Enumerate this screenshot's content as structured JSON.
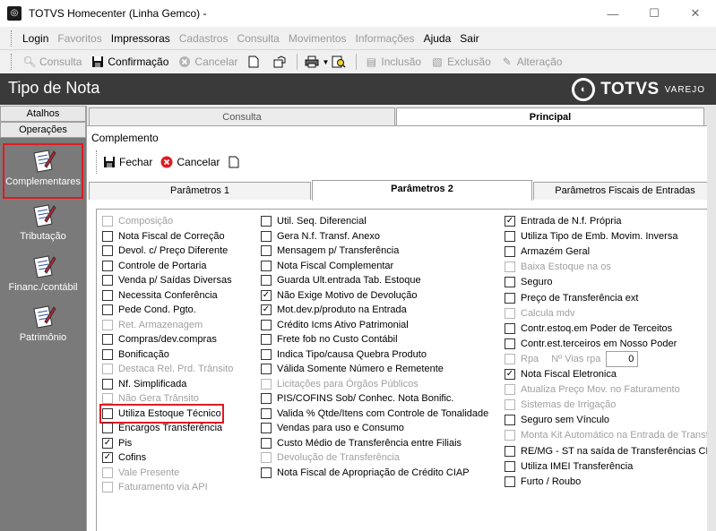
{
  "window": {
    "title": "TOTVS Homecenter (Linha Gemco) -",
    "minimize": "—",
    "maximize": "☐",
    "close": "✕"
  },
  "menu": [
    {
      "label": "Login",
      "enabled": true
    },
    {
      "label": "Favoritos",
      "enabled": false
    },
    {
      "label": "Impressoras",
      "enabled": true
    },
    {
      "label": "Cadastros",
      "enabled": false
    },
    {
      "label": "Consulta",
      "enabled": false
    },
    {
      "label": "Movimentos",
      "enabled": false
    },
    {
      "label": "Informações",
      "enabled": false
    },
    {
      "label": "Ajuda",
      "enabled": true
    },
    {
      "label": "Sair",
      "enabled": true
    }
  ],
  "toolbar": {
    "consulta": "Consulta",
    "confirmacao": "Confirmação",
    "cancelar": "Cancelar",
    "inclusao": "Inclusão",
    "exclusao": "Exclusão",
    "alteracao": "Alteração"
  },
  "header": {
    "title": "Tipo de Nota",
    "brand": "TOTVS",
    "brand_sub": "VAREJO"
  },
  "nav": {
    "atalhos": "Atalhos",
    "operacoes": "Operações",
    "items": [
      {
        "label": "Complementares",
        "selected": true
      },
      {
        "label": "Tributação",
        "selected": false
      },
      {
        "label": "Financ./contábil",
        "selected": false
      },
      {
        "label": "Patrimônio",
        "selected": false
      }
    ]
  },
  "top_tabs": {
    "consulta": "Consulta",
    "principal": "Principal"
  },
  "dialog": {
    "title": "Complemento",
    "fechar": "Fechar",
    "cancelar": "Cancelar",
    "tabs": {
      "p1": "Parâmetros 1",
      "p2": "Parâmetros 2",
      "p3": "Parâmetros Fiscais de Entradas"
    }
  },
  "params": {
    "col1": [
      {
        "label": "Composição",
        "checked": false,
        "disabled": true
      },
      {
        "label": "Nota Fiscal de Correção",
        "checked": false,
        "disabled": false
      },
      {
        "label": "Devol. c/ Preço Diferente",
        "checked": false,
        "disabled": false
      },
      {
        "label": "Controle de Portaria",
        "checked": false,
        "disabled": false
      },
      {
        "label": "Venda p/ Saídas Diversas",
        "checked": false,
        "disabled": false
      },
      {
        "label": "Necessita Conferência",
        "checked": false,
        "disabled": false
      },
      {
        "label": "Pede Cond. Pgto.",
        "checked": false,
        "disabled": false
      },
      {
        "label": "Ret. Armazenagem",
        "checked": false,
        "disabled": true
      },
      {
        "label": "Compras/dev.compras",
        "checked": false,
        "disabled": false
      },
      {
        "label": "Bonificação",
        "checked": false,
        "disabled": false
      },
      {
        "label": "Destaca Rel. Prd. Trânsito",
        "checked": false,
        "disabled": true
      },
      {
        "label": "Nf. Simplificada",
        "checked": false,
        "disabled": false
      },
      {
        "label": "Não Gera Trânsito",
        "checked": false,
        "disabled": true
      },
      {
        "label": "Utiliza Estoque Técnico",
        "checked": false,
        "disabled": false,
        "highlight": true
      },
      {
        "label": "Encargos Transferência",
        "checked": false,
        "disabled": false
      },
      {
        "label": "Pis",
        "checked": true,
        "disabled": false
      },
      {
        "label": "Cofins",
        "checked": true,
        "disabled": false
      },
      {
        "label": "Vale Presente",
        "checked": false,
        "disabled": true
      },
      {
        "label": "Faturamento via API",
        "checked": false,
        "disabled": true
      }
    ],
    "col2": [
      {
        "label": "Util. Seq. Diferencial",
        "checked": false,
        "disabled": false
      },
      {
        "label": "Gera N.f. Transf. Anexo",
        "checked": false,
        "disabled": false
      },
      {
        "label": "Mensagem p/ Transferência",
        "checked": false,
        "disabled": false
      },
      {
        "label": "Nota Fiscal Complementar",
        "checked": false,
        "disabled": false
      },
      {
        "label": "Guarda Ult.entrada Tab. Estoque",
        "checked": false,
        "disabled": false
      },
      {
        "label": "Não Exige Motivo de Devolução",
        "checked": true,
        "disabled": false
      },
      {
        "label": "Mot.dev.p/produto na Entrada",
        "checked": true,
        "disabled": false
      },
      {
        "label": "Crédito Icms Ativo Patrimonial",
        "checked": false,
        "disabled": false
      },
      {
        "label": "Frete fob no Custo Contábil",
        "checked": false,
        "disabled": false
      },
      {
        "label": "Indica Tipo/causa Quebra Produto",
        "checked": false,
        "disabled": false
      },
      {
        "label": "Válida Somente Número e Remetente",
        "checked": false,
        "disabled": false
      },
      {
        "label": "Licitações para Órgãos Públicos",
        "checked": false,
        "disabled": true
      },
      {
        "label": "PIS/COFINS Sob/ Conhec. Nota Bonific.",
        "checked": false,
        "disabled": false
      },
      {
        "label": "Valida % Qtde/Itens com Controle de Tonalidade",
        "checked": false,
        "disabled": false
      },
      {
        "label": "Vendas para uso e Consumo",
        "checked": false,
        "disabled": false
      },
      {
        "label": "Custo Médio de Transferência entre Filiais",
        "checked": false,
        "disabled": false
      },
      {
        "label": "Devolução de Transferência",
        "checked": false,
        "disabled": true
      },
      {
        "label": "Nota Fiscal de Apropriação de Crédito CIAP",
        "checked": false,
        "disabled": false
      }
    ],
    "col3": [
      {
        "label": "Entrada de N.f. Própria",
        "checked": true,
        "disabled": false
      },
      {
        "label": "Utiliza Tipo de Emb. Movim. Inversa",
        "checked": false,
        "disabled": false
      },
      {
        "label": "Armazém Geral",
        "checked": false,
        "disabled": false
      },
      {
        "label": "Baixa Estoque na os",
        "checked": false,
        "disabled": true
      },
      {
        "label": "Seguro",
        "checked": false,
        "disabled": false
      },
      {
        "label": "Preço de Transferência ext",
        "checked": false,
        "disabled": false
      },
      {
        "label": "Calcula mdv",
        "checked": false,
        "disabled": true
      },
      {
        "label": "Contr.estoq.em Poder de Terceitos",
        "checked": false,
        "disabled": false
      },
      {
        "label": "Contr.est.terceiros em Nosso Poder",
        "checked": false,
        "disabled": false
      },
      {
        "label": "Rpa",
        "checked": false,
        "disabled": true,
        "extra_label": "Nº Vias rpa",
        "extra_value": "0"
      },
      {
        "label": "Nota Fiscal Eletronica",
        "checked": true,
        "disabled": false
      },
      {
        "label": "Atualiza Preço Mov. no Faturamento",
        "checked": false,
        "disabled": true
      },
      {
        "label": "Sistemas de Irrigação",
        "checked": false,
        "disabled": true
      },
      {
        "label": "Seguro sem Vínculo",
        "checked": false,
        "disabled": false
      },
      {
        "label": "Monta Kit Automático na Entrada de Transferê",
        "checked": false,
        "disabled": true
      },
      {
        "label": "RE/MG - ST na saída de Transferências CD",
        "checked": false,
        "disabled": false
      },
      {
        "label": "Utiliza IMEI Transferência",
        "checked": false,
        "disabled": false
      },
      {
        "label": "Furto / Roubo",
        "checked": false,
        "disabled": false
      }
    ]
  }
}
